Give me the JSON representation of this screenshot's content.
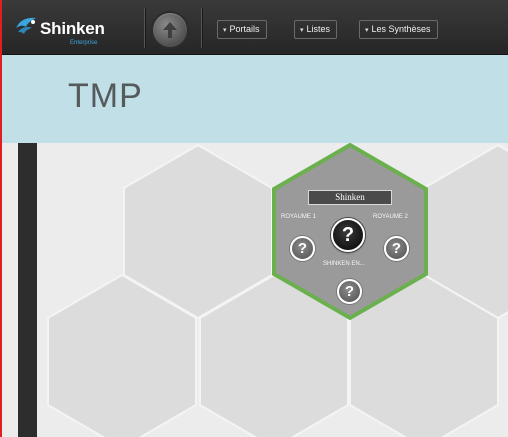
{
  "header": {
    "logo_text": "Shinken",
    "logo_subtext": "Enterprise",
    "home_icon": "arrow-up-icon",
    "menus": [
      {
        "label": "Portails",
        "icon": "caret-down-icon"
      },
      {
        "label": "Listes",
        "icon": "caret-down-icon"
      },
      {
        "label": "Les Synthèses",
        "icon": "caret-down-icon"
      }
    ]
  },
  "page": {
    "title": "TMP"
  },
  "hexmap": {
    "node": {
      "title": "Shinken",
      "status_color": "#6ab04c",
      "items": [
        {
          "label": "ROYAUME 1",
          "status": "unknown",
          "icon": "question-icon"
        },
        {
          "label": "",
          "status": "unknown",
          "icon": "question-icon"
        },
        {
          "label": "ROYAUME 2",
          "status": "unknown",
          "icon": "question-icon"
        },
        {
          "label": "SHINKEN EN...",
          "status": "unknown",
          "icon": "question-icon"
        }
      ]
    }
  },
  "colors": {
    "topbar": "#2e2e2e",
    "accent_blue": "#3aa7e0",
    "title_band": "#c0dfe6",
    "content_bg": "#ececec",
    "hex_fill": "#dcdcdc",
    "node_fill": "#9a9a9a",
    "node_border": "#6ab04c"
  }
}
